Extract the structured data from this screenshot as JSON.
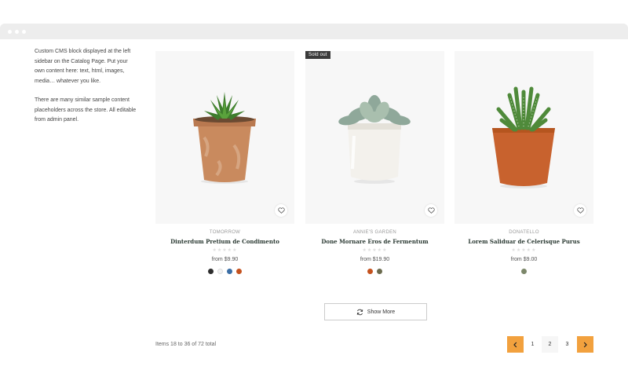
{
  "sidebar": {
    "paragraphs": [
      "Custom CMS block displayed at the left sidebar on the Catalog Page. Put your own content here: text, html, images, media… whatever you like.",
      "There are many similar sample content placeholders across the store. All editable from admin panel."
    ]
  },
  "products": [
    {
      "vendor": "TOMORROW",
      "title": "Dinterdum Pretium de Condimento",
      "price": "from $9.90",
      "badge": "",
      "stars": "★★★★★",
      "swatches": [
        "#2d2d2d",
        "#f2f2f2",
        "#3b6ea5",
        "#c4521e"
      ]
    },
    {
      "vendor": "ANNIE'S GARDEN",
      "title": "Done Mornare Eros de Fermentum",
      "price": "from $19.90",
      "badge": "Sold out",
      "stars": "★★★★★",
      "swatches": [
        "#c4521e",
        "#6b6b4e"
      ]
    },
    {
      "vendor": "DONATELLO",
      "title": "Lorem Saliduar de Celerisque Purus",
      "price": "from $9.00",
      "badge": "",
      "stars": "★★★★★",
      "swatches": [
        "#7c876a"
      ]
    }
  ],
  "show_more": {
    "label": "Show More",
    "icon": "refresh-icon"
  },
  "pagination": {
    "summary": "Items 18 to 36 of 72 total",
    "pages": [
      "1",
      "2",
      "3"
    ],
    "active_page": "2",
    "prev_icon": "chevron-left-icon",
    "next_icon": "chevron-right-icon",
    "accent": "#f2a13e"
  }
}
